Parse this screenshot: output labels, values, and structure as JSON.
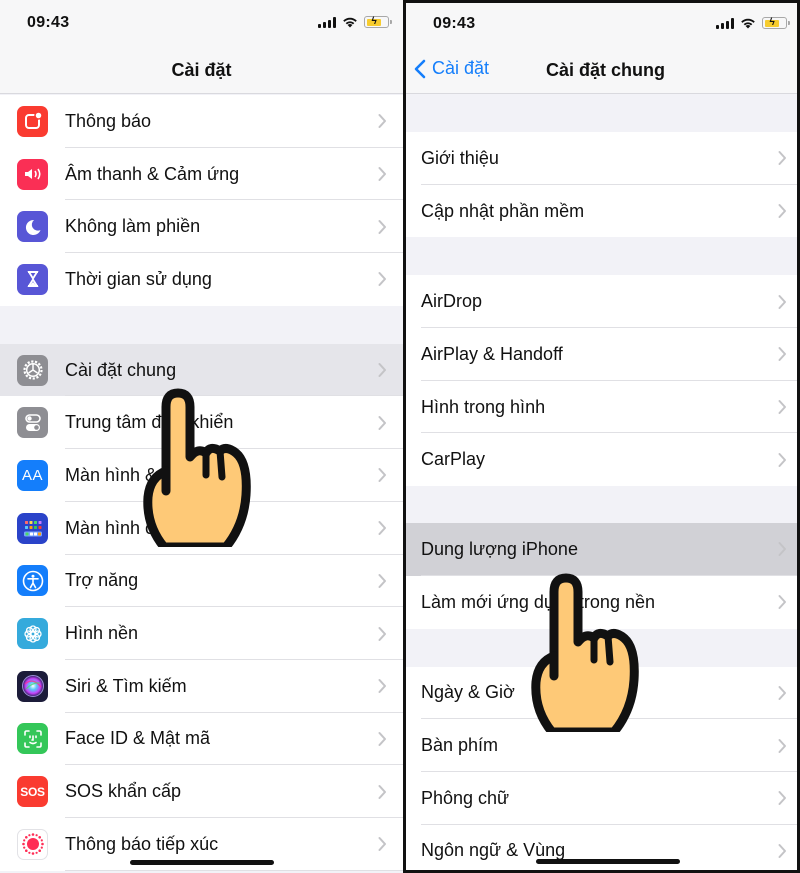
{
  "left": {
    "status": {
      "time": "09:43"
    },
    "nav": {
      "title": "Cài đặt"
    },
    "groups": [
      {
        "items": [
          {
            "label": "Thông báo",
            "icon": "notifications-icon",
            "color": "#fa3b30"
          },
          {
            "label": "Âm thanh & Cảm ứng",
            "icon": "sounds-icon",
            "color": "#fa2f55"
          },
          {
            "label": "Không làm phiền",
            "icon": "moon-icon",
            "color": "#5856d6"
          },
          {
            "label": "Thời gian sử dụng",
            "icon": "hourglass-icon",
            "color": "#5856d6"
          }
        ]
      },
      {
        "items": [
          {
            "label": "Cài đặt chung",
            "icon": "gear-icon",
            "color": "#8e8e93",
            "highlighted": true
          },
          {
            "label": "Trung tâm điều khiển",
            "icon": "toggles-icon",
            "color": "#8e8e93"
          },
          {
            "label": "Màn hình & Độ sáng",
            "icon": "text-size-icon",
            "color": "#147efb"
          },
          {
            "label": "Màn hình chính",
            "icon": "home-screen-icon",
            "color": "#2a43c9"
          },
          {
            "label": "Trợ năng",
            "icon": "accessibility-icon",
            "color": "#147efb"
          },
          {
            "label": "Hình nền",
            "icon": "wallpaper-icon",
            "color": "#35aadc"
          },
          {
            "label": "Siri & Tìm kiếm",
            "icon": "siri-icon",
            "color": "#1c1c3a"
          },
          {
            "label": "Face ID & Mật mã",
            "icon": "face-id-icon",
            "color": "#34c759"
          },
          {
            "label": "SOS khẩn cấp",
            "icon": "sos-icon",
            "color": "#fa3b30",
            "icon_text": "SOS"
          },
          {
            "label": "Thông báo tiếp xúc",
            "icon": "exposure-icon",
            "color": "#ffffff"
          }
        ]
      }
    ]
  },
  "right": {
    "status": {
      "time": "09:43"
    },
    "nav": {
      "title": "Cài đặt chung",
      "back_label": "Cài đặt"
    },
    "groups": [
      {
        "items": [
          {
            "label": "Giới thiệu"
          },
          {
            "label": "Cập nhật phần mềm"
          }
        ]
      },
      {
        "items": [
          {
            "label": "AirDrop"
          },
          {
            "label": "AirPlay & Handoff"
          },
          {
            "label": "Hình trong hình"
          },
          {
            "label": "CarPlay"
          }
        ]
      },
      {
        "items": [
          {
            "label": "Dung lượng iPhone",
            "highlighted": true
          },
          {
            "label": "Làm mới ứng dụng trong nền"
          }
        ]
      },
      {
        "items": [
          {
            "label": "Ngày & Giờ"
          },
          {
            "label": "Bàn phím"
          },
          {
            "label": "Phông chữ"
          },
          {
            "label": "Ngôn ngữ & Vùng"
          }
        ]
      }
    ]
  },
  "colors": {
    "accent": "#147efb",
    "hand_fill": "#fec977",
    "background": "#f2f2f7"
  }
}
